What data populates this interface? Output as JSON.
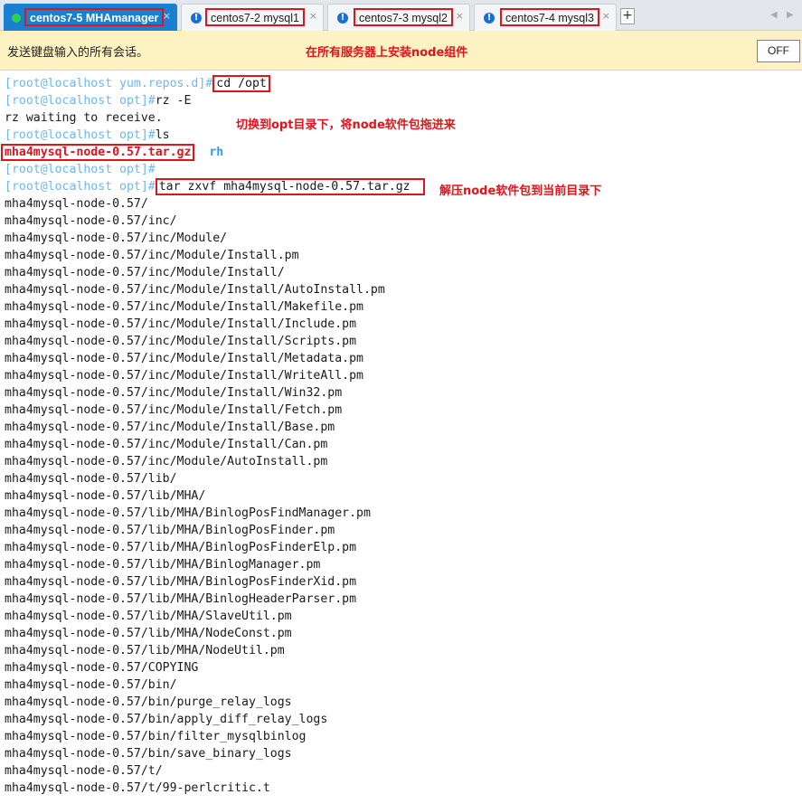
{
  "tabs": [
    {
      "label": "centos7-5 MHAmanager",
      "status": "connected",
      "active": true
    },
    {
      "label": "centos7-2 mysql1",
      "status": "warning",
      "active": false
    },
    {
      "label": "centos7-3 mysql2",
      "status": "warning",
      "active": false
    },
    {
      "label": "centos7-4 mysql3",
      "status": "warning",
      "active": false
    }
  ],
  "tab_close_glyph": "×",
  "add_tab_glyph": "+",
  "nav_glyphs": {
    "prev": "◀",
    "next": "▶"
  },
  "warning_glyph": "!",
  "notice": {
    "text": "发送键盘输入的所有会话。",
    "annotation": "在所有服务器上安装node组件",
    "off_label": "OFF"
  },
  "terminal": {
    "prompt_repos": "[root@localhost yum.repos.d]#",
    "prompt_opt": "[root@localhost opt]#",
    "cmd_cd": "cd /opt",
    "cmd_rz": "rz -E",
    "rz_waiting": "rz waiting to receive.",
    "cmd_ls": "ls",
    "ls_file": "mha4mysql-node-0.57.tar.gz",
    "ls_dir": "rh",
    "cmd_tar": "tar zxvf mha4mysql-node-0.57.tar.gz",
    "annotation_upload": "切换到opt目录下，将node软件包拖进来",
    "annotation_extract": "解压node软件包到当前目录下",
    "output": [
      "mha4mysql-node-0.57/",
      "mha4mysql-node-0.57/inc/",
      "mha4mysql-node-0.57/inc/Module/",
      "mha4mysql-node-0.57/inc/Module/Install.pm",
      "mha4mysql-node-0.57/inc/Module/Install/",
      "mha4mysql-node-0.57/inc/Module/Install/AutoInstall.pm",
      "mha4mysql-node-0.57/inc/Module/Install/Makefile.pm",
      "mha4mysql-node-0.57/inc/Module/Install/Include.pm",
      "mha4mysql-node-0.57/inc/Module/Install/Scripts.pm",
      "mha4mysql-node-0.57/inc/Module/Install/Metadata.pm",
      "mha4mysql-node-0.57/inc/Module/Install/WriteAll.pm",
      "mha4mysql-node-0.57/inc/Module/Install/Win32.pm",
      "mha4mysql-node-0.57/inc/Module/Install/Fetch.pm",
      "mha4mysql-node-0.57/inc/Module/Install/Base.pm",
      "mha4mysql-node-0.57/inc/Module/Install/Can.pm",
      "mha4mysql-node-0.57/inc/Module/AutoInstall.pm",
      "mha4mysql-node-0.57/lib/",
      "mha4mysql-node-0.57/lib/MHA/",
      "mha4mysql-node-0.57/lib/MHA/BinlogPosFindManager.pm",
      "mha4mysql-node-0.57/lib/MHA/BinlogPosFinder.pm",
      "mha4mysql-node-0.57/lib/MHA/BinlogPosFinderElp.pm",
      "mha4mysql-node-0.57/lib/MHA/BinlogManager.pm",
      "mha4mysql-node-0.57/lib/MHA/BinlogPosFinderXid.pm",
      "mha4mysql-node-0.57/lib/MHA/BinlogHeaderParser.pm",
      "mha4mysql-node-0.57/lib/MHA/SlaveUtil.pm",
      "mha4mysql-node-0.57/lib/MHA/NodeConst.pm",
      "mha4mysql-node-0.57/lib/MHA/NodeUtil.pm",
      "mha4mysql-node-0.57/COPYING",
      "mha4mysql-node-0.57/bin/",
      "mha4mysql-node-0.57/bin/purge_relay_logs",
      "mha4mysql-node-0.57/bin/apply_diff_relay_logs",
      "mha4mysql-node-0.57/bin/filter_mysqlbinlog",
      "mha4mysql-node-0.57/bin/save_binary_logs",
      "mha4mysql-node-0.57/t/",
      "mha4mysql-node-0.57/t/99-perlcritic.t"
    ]
  },
  "colors": {
    "tab_active_bg": "#1b7fd1",
    "annotation_red": "#e0141b",
    "prompt_blue": "#6fb6f2",
    "notice_bg": "#fdf2c2",
    "connected_green": "#2ed24a",
    "warning_blue": "#1a6fd6"
  }
}
